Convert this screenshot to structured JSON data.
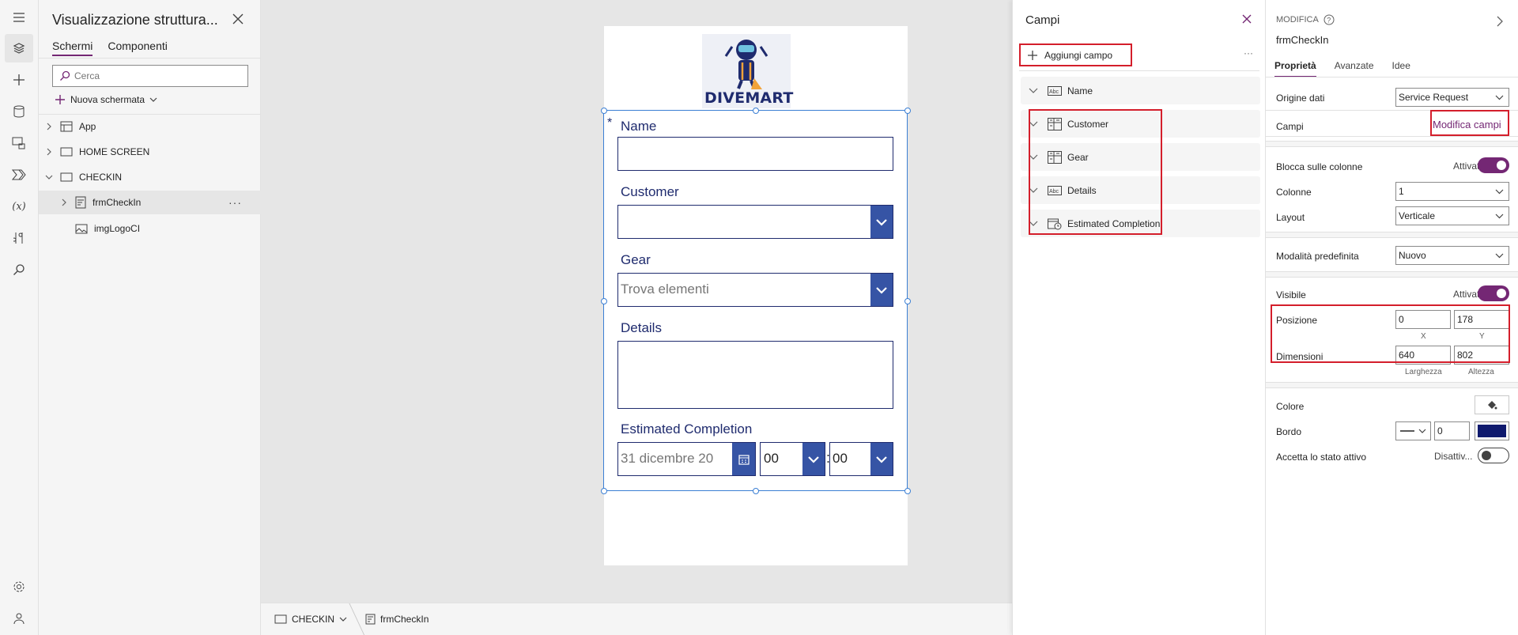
{
  "rail": {
    "icons": [
      "hamburger-icon",
      "layers-icon",
      "plus-icon",
      "database-icon",
      "media-icon",
      "power-automate-icon",
      "variables-icon",
      "tools-icon",
      "search-icon",
      "settings-icon",
      "account-icon"
    ],
    "variables_glyph": "(x)"
  },
  "tree": {
    "title": "Visualizzazione struttura...",
    "tabs": [
      "Schermi",
      "Componenti"
    ],
    "search_placeholder": "Cerca",
    "new_screen_label": "Nuova schermata",
    "items": [
      {
        "label": "App"
      },
      {
        "label": "HOME SCREEN"
      },
      {
        "label": "CHECKIN"
      },
      {
        "label": "frmCheckIn",
        "more": "···"
      },
      {
        "label": "imgLogoCI"
      }
    ]
  },
  "canvas": {
    "logo_text": "DIVEMART",
    "required_marker": "*",
    "fields": {
      "name": "Name",
      "customer": "Customer",
      "gear": "Gear",
      "gear_placeholder": "Trova elementi",
      "details": "Details",
      "estimated": "Estimated Completion",
      "date_value": "31 dicembre 20",
      "hour_value": "00",
      "time_separator": ":",
      "minute_value": "00"
    },
    "accent": "#3654a5",
    "label_color": "#1f2b6e"
  },
  "bottombar": {
    "screen": "CHECKIN",
    "control": "frmCheckIn"
  },
  "fields_panel": {
    "title": "Campi",
    "add_label": "Aggiungi campo",
    "more": "···",
    "rows": [
      {
        "label": "Name",
        "icon": "text-field-icon"
      },
      {
        "label": "Customer",
        "icon": "combobox-icon"
      },
      {
        "label": "Gear",
        "icon": "combobox-icon"
      },
      {
        "label": "Details",
        "icon": "text-field-icon"
      },
      {
        "label": "Estimated Completion",
        "icon": "datetime-icon"
      }
    ],
    "highlight_color": "#d41e2b"
  },
  "props": {
    "section": "MODIFICA",
    "control_name": "frmCheckIn",
    "tabs": [
      "Proprietà",
      "Avanzate",
      "Idee"
    ],
    "data_source_label": "Origine dati",
    "data_source_value": "Service Request",
    "fields_label": "Campi",
    "edit_fields_link": "Modifica campi",
    "snap_label": "Blocca sulle colonne",
    "snap_state": "Attivato",
    "columns_label": "Colonne",
    "columns_value": "1",
    "layout_label": "Layout",
    "layout_value": "Verticale",
    "default_mode_label": "Modalità predefinita",
    "default_mode_value": "Nuovo",
    "visible_label": "Visibile",
    "visible_state": "Attivato",
    "position_label": "Posizione",
    "pos_x": "0",
    "pos_y": "178",
    "x_label": "X",
    "y_label": "Y",
    "size_label": "Dimensioni",
    "width": "640",
    "height": "802",
    "width_label": "Larghezza",
    "height_label": "Altezza",
    "color_label": "Colore",
    "border_label": "Bordo",
    "border_value": "0",
    "border_color": "#0f1a6e",
    "accept_focus_label": "Accetta lo stato attivo",
    "accept_focus_state": "Disattiv...",
    "accent": "#742774"
  }
}
